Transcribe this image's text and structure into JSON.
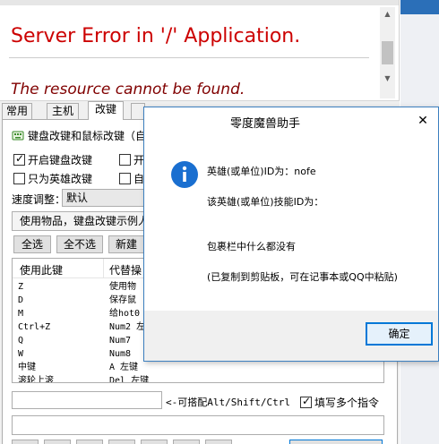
{
  "browser": {
    "error_title": "Server Error in '/' Application.",
    "error_subtitle": "The resource cannot be found."
  },
  "app": {
    "tabs": [
      "常用",
      "主机",
      "改键",
      "",
      "",
      "",
      "",
      "",
      ""
    ],
    "group_title": "键盘改键和鼠标改键（自",
    "checkboxes": {
      "enable_key_remap": "开启键盘改键",
      "hero_only": "只为英雄改键",
      "right_col_1": "开",
      "right_col_2": "自"
    },
    "speed": {
      "label": "速度调整：",
      "value": "默认"
    },
    "example_combo": "使用物品，键盘改键示例人",
    "buttons": {
      "select_all": "全选",
      "select_none": "全不选",
      "new": "新建"
    },
    "list": {
      "col_use_key": "使用此键",
      "col_replace": "代替操",
      "rows": [
        {
          "key": "Z",
          "action": "使用物"
        },
        {
          "key": "D",
          "action": "保存鼠"
        },
        {
          "key": "M",
          "action": "给hot0"
        },
        {
          "key": "Ctrl+Z",
          "action": "Num2 左"
        },
        {
          "key": "Q",
          "action": "Num7"
        },
        {
          "key": "W",
          "action": "Num8"
        },
        {
          "key": "中键",
          "action": "A 左键"
        },
        {
          "key": "滚轮上滚",
          "action": "Del 左键"
        }
      ]
    },
    "modifier_hint": "<-可搭配Alt/Shift/Ctrl",
    "multi_cmd_label": "填写多个指令",
    "bottom_buttons": [
      "",
      "",
      "",
      "",
      "",
      "",
      "",
      ""
    ]
  },
  "dialog": {
    "title": "零度魔兽助手",
    "close_glyph": "✕",
    "line1": "英雄(或单位)ID为：nofe",
    "line2": "该英雄(或单位)技能ID为：",
    "line3": "包裹栏中什么都没有",
    "line4": "(已复制到剪贴板，可在记事本或QQ中粘贴)",
    "ok": "确定"
  },
  "icons": {
    "info": "info-icon",
    "keyboard": "keyboard-icon",
    "close": "close-icon"
  },
  "colors": {
    "error_red": "#cc0000",
    "error_maroon": "#800000",
    "dialog_border": "#3c7fbf",
    "info_blue": "#1a6fd0",
    "ok_focus": "#0078d7"
  }
}
